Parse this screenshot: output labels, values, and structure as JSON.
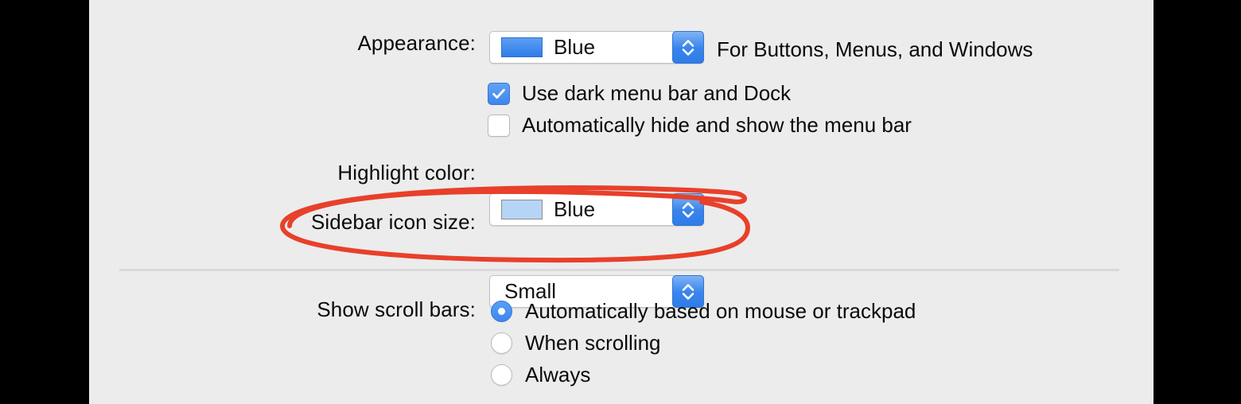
{
  "window": {
    "background_color": "#ececec",
    "letterbox_color": "#000000"
  },
  "settings_panel": {
    "rows": [
      {
        "label": "Appearance:",
        "control": "popup-button",
        "value": "Blue",
        "swatch_color": "#3d86ec",
        "helper_text": "For Buttons, Menus, and Windows"
      },
      {
        "label": "Highlight color:",
        "control": "popup-button",
        "value": "Blue",
        "swatch_color": "#b6d4f6"
      },
      {
        "label": "Sidebar icon size:",
        "control": "popup-button",
        "value": "Small"
      },
      {
        "label": "Show scroll bars:",
        "control": "radio-group"
      }
    ],
    "checkboxes": [
      {
        "label": "Use dark menu bar and Dock",
        "checked": true
      },
      {
        "label": "Automatically hide and show the menu bar",
        "checked": false
      }
    ],
    "scroll_bar_options": [
      {
        "label": "Automatically based on mouse or trackpad",
        "selected": true
      },
      {
        "label": "When scrolling",
        "selected": false
      },
      {
        "label": "Always",
        "selected": false
      }
    ]
  },
  "annotation": {
    "shape": "ellipse",
    "color": "#e8402a",
    "stroke_width": 6,
    "target": "Sidebar icon size:"
  },
  "icons": {
    "stepper": "up-down-chevron-icon",
    "check": "checkmark-icon"
  }
}
